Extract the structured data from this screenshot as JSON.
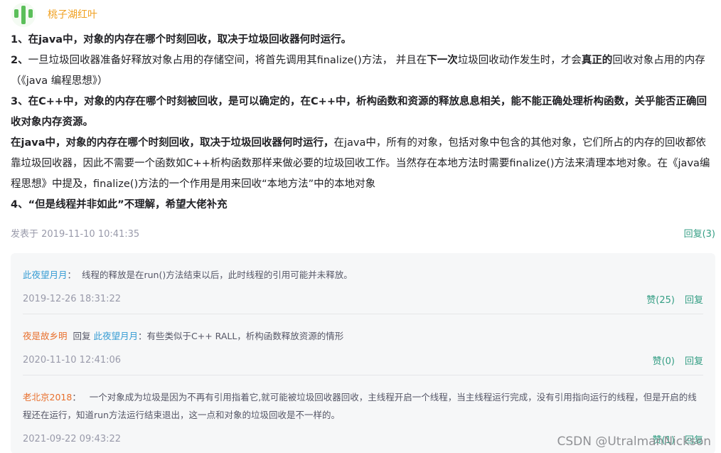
{
  "comment": {
    "author": "桃子湖红叶",
    "p1": "1、在java中，对象的内存在哪个时刻回收，取决于垃圾回收器何时运行。",
    "p2_a": "2、",
    "p2_b": "一旦垃圾回收器准备好释放对象占用的存储空间，将首先调用其finalize()方法， 并且在",
    "p2_c": "下一次",
    "p2_d": "垃圾回收动作发生时，才会",
    "p2_e": "真正的",
    "p2_f": "回收对象占用的内存（《java 编程思想》）",
    "p3": "3、在C++中，对象的内存在哪个时刻被回收，是可以确定的，在C++中，析构函数和资源的释放息息相关，能不能正确处理析构函数，关乎能否正确回收对象内存资源。",
    "p4_bold": "在java中，对象的内存在哪个时刻回收，取决于垃圾回收器何时运行，",
    "p4_rest": "在java中，所有的对象，包括对象中包含的其他对象，它们所占的内存的回收都依靠垃圾回收器，因此不需要一个函数如C++析构函数那样来做必要的垃圾回收工作。当然存在本地方法时需要finalize()方法来清理本地对象。在《java编程思想》中提及，finalize()方法的一个作用是用来回收“本地方法”中的本地对象",
    "p5": "4、“但是线程并非如此”不理解，希望大佬补充",
    "posted": "发表于 2019-11-10 10:41:35",
    "reply_count": "回复(3)"
  },
  "replies": [
    {
      "author": "此夜望月月",
      "sep": "：",
      "text": "线程的释放是在run()方法结束以后，此时线程的引用可能并未释放。",
      "time": "2019-12-26 18:31:22",
      "like": "赞(25)",
      "reply": "回复"
    },
    {
      "author": "夜是故乡明",
      "mid": "回复",
      "target": "此夜望月月",
      "sep": "：",
      "text": "有些类似于C++ RALL，析构函数释放资源的情形",
      "time": "2020-11-10 12:41:06",
      "like": "赞(0)",
      "reply": "回复"
    },
    {
      "author": "老北京2018",
      "sep": "：",
      "text": "一个对象成为垃圾是因为不再有引用指着它,就可能被垃圾回收器回收，主线程开启一个线程，当主线程运行完成，没有引用指向运行的线程，但是开启的线程还在运行，知道run方法运行结束退出，这一点和对象的垃圾回收是不一样的。",
      "time": "2021-09-22 09:43:22",
      "like": "赞(1)",
      "reply": "回复"
    }
  ],
  "watermark": "CSDN @UtralmanNickson",
  "colors": {
    "author_name": "#f0a020",
    "link_green": "#349e84",
    "blue_name": "#349bd3",
    "orange_name": "#e86f2c",
    "muted": "#999aaa"
  }
}
